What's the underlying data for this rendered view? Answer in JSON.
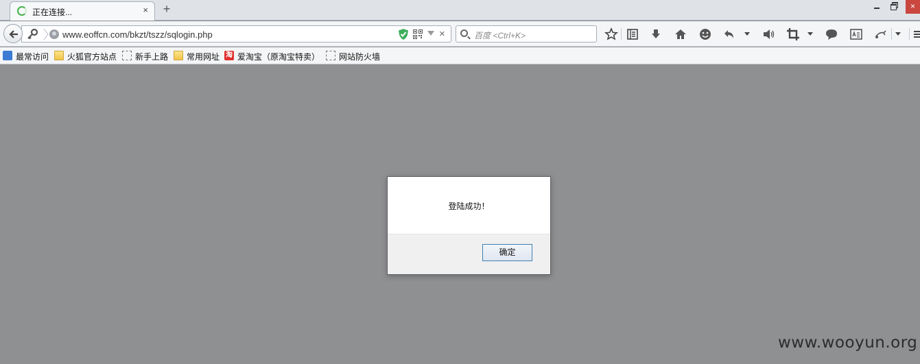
{
  "tab": {
    "title": "正在连接...",
    "close": "×",
    "new_tab": "+"
  },
  "window": {
    "close": "×"
  },
  "urlbar": {
    "url": "www.eoffcn.com/bkzt/tszz/sqlogin.php",
    "stop": "×"
  },
  "search": {
    "placeholder": "百度 <Ctrl+K>"
  },
  "bookmarks": [
    {
      "label": "最常访问",
      "icon": "most-visited-icon"
    },
    {
      "label": "火狐官方站点",
      "icon": "folder-icon"
    },
    {
      "label": "新手上路",
      "icon": "page-icon"
    },
    {
      "label": "常用网址",
      "icon": "folder-icon"
    },
    {
      "label": "爱淘宝（原淘宝特卖）",
      "icon": "taobao-icon"
    },
    {
      "label": "网站防火墙",
      "icon": "page-icon"
    }
  ],
  "taobao_glyph": "淘",
  "dialog": {
    "message": "登陆成功！",
    "ok_label": "确定"
  },
  "watermark": "www.wooyun.org",
  "colors": {
    "accent_green": "#46b34a",
    "page_overlay": "#8f9092",
    "button_border": "#3c7fb1",
    "close_red": "#c9473f"
  }
}
